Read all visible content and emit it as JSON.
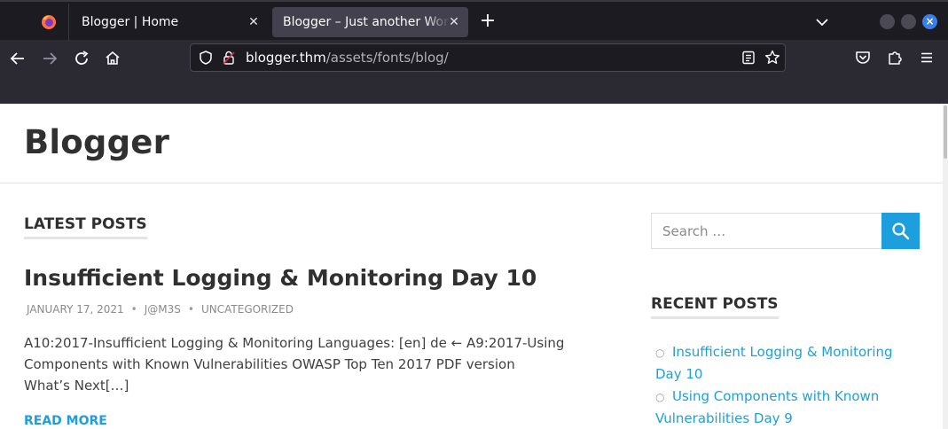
{
  "browser": {
    "tabs": [
      {
        "title": "Blogger | Home",
        "active": false
      },
      {
        "title": "Blogger – Just another WordPress site",
        "active": true
      }
    ],
    "url_host": "blogger.thm",
    "url_path": "/assets/fonts/blog/",
    "accent_color": "#3a7fe5"
  },
  "site": {
    "title": "Blogger"
  },
  "main": {
    "section_title": "LATEST POSTS",
    "post": {
      "title": "Insufficient Logging & Monitoring Day 10",
      "date": "JANUARY 17, 2021",
      "author": "J@M3S",
      "category": "UNCATEGORIZED",
      "excerpt": "A10:2017-Insufficient Logging & Monitoring Languages: [en] de ← A9:2017-Using Components with Known Vulnerabilities OWASP Top Ten 2017 PDF version What’s Next[…]",
      "read_more": "READ MORE"
    }
  },
  "sidebar": {
    "search_placeholder": "Search …",
    "recent_title": "RECENT POSTS",
    "recent_posts": [
      "Insufficient Logging & Monitoring Day 10",
      "Using Components with Known Vulnerabilities Day 9"
    ],
    "link_color": "#1e9fdd"
  }
}
